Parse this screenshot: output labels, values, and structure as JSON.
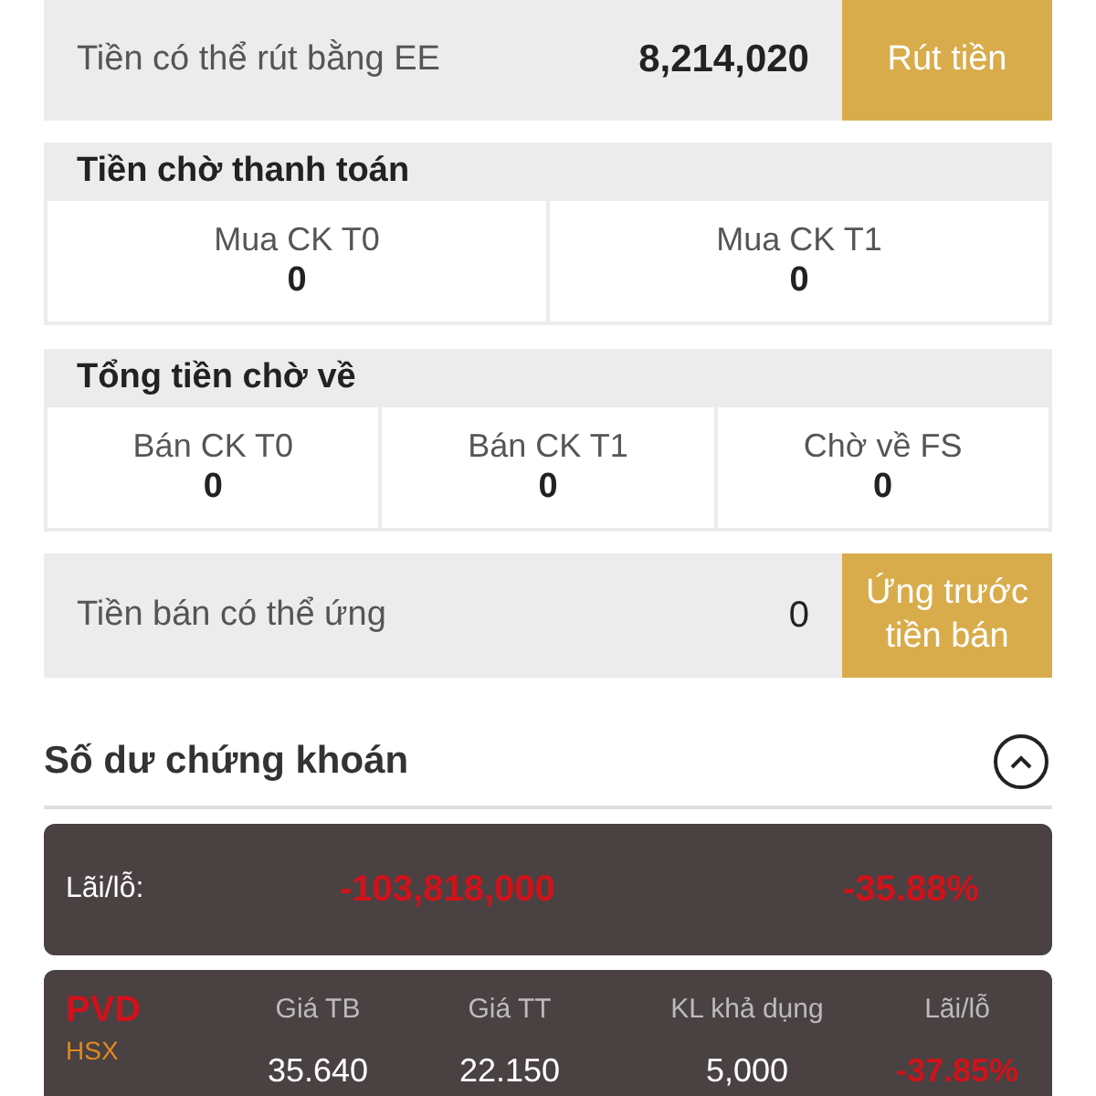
{
  "withdraw": {
    "label": "Tiền có thể rút bằng EE",
    "value": "8,214,020",
    "button": "Rút tiền"
  },
  "pending_payment": {
    "title": "Tiền chờ thanh toán",
    "items": [
      {
        "label": "Mua CK T0",
        "value": "0"
      },
      {
        "label": "Mua CK T1",
        "value": "0"
      }
    ]
  },
  "incoming": {
    "title": "Tổng tiền chờ về",
    "items": [
      {
        "label": "Bán CK T0",
        "value": "0"
      },
      {
        "label": "Bán CK T1",
        "value": "0"
      },
      {
        "label": "Chờ về FS",
        "value": "0"
      }
    ]
  },
  "advance": {
    "label": "Tiền bán có thể ứng",
    "value": "0",
    "button": "Ứng trước tiền bán"
  },
  "holdings": {
    "title": "Số dư chứng khoán",
    "expanded": true,
    "summary": {
      "label": "Lãi/lỗ:",
      "amount": "-103,818,000",
      "percent": "-35.88%"
    },
    "columns": [
      "Giá TB",
      "Giá TT",
      "KL khả dụng",
      "Lãi/lỗ"
    ],
    "rows": [
      {
        "symbol": "PVD",
        "exchange": "HSX",
        "cells": [
          "35.640",
          "22.150",
          "5,000",
          "-37.85%"
        ]
      }
    ]
  }
}
